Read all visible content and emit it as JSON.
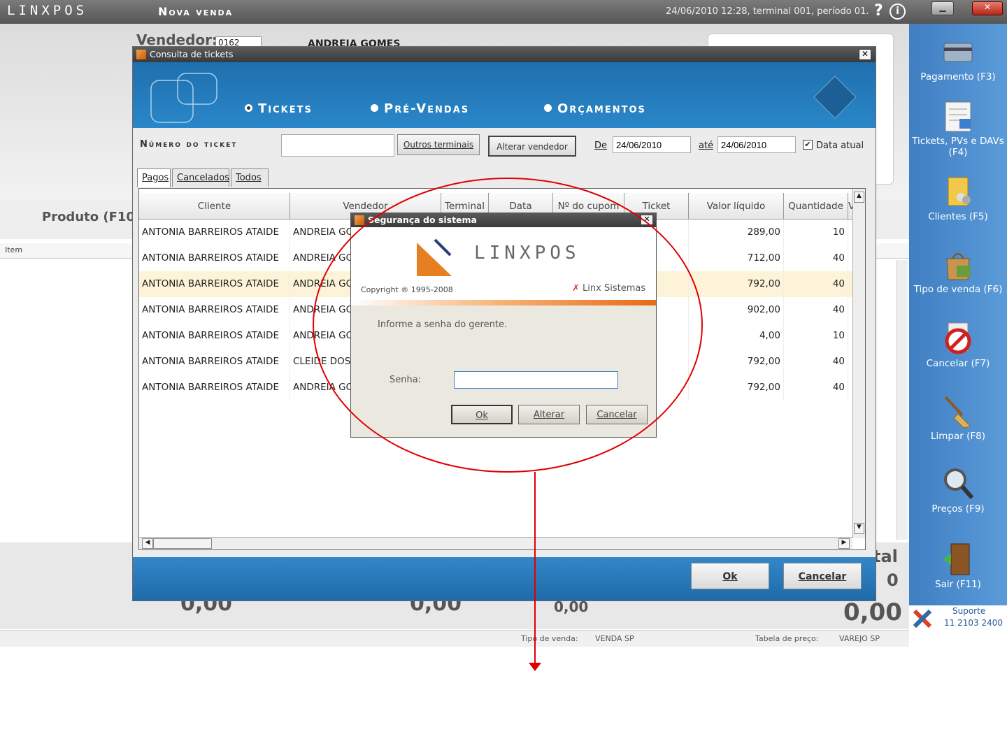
{
  "window": {
    "logo": "LINXPOS",
    "title": "Nova venda",
    "info": "24/06/2010 12:28, terminal 001, período 01."
  },
  "background": {
    "vendedor_label": "Vendedor:",
    "vendedor_code": "0162",
    "vendedor_name": "ANDREIA GOMES",
    "produto_label": "Produto (F10",
    "item_col": "Item",
    "total_label": "tal",
    "total_small": "0",
    "total_big": "0,00",
    "val1": "0,00",
    "val2": "0,00",
    "val3": "0,00",
    "tipo_venda_label": "Tipo de venda:",
    "tipo_venda": "VENDA SP",
    "tabela_label": "Tabela de preço:",
    "tabela": "VAREJO SP"
  },
  "sidebar": {
    "items": [
      {
        "label": "Pagamento (F3)",
        "icon": "card-icon"
      },
      {
        "label": "Tickets, PVs e DAVs (F4)",
        "icon": "receipt-icon"
      },
      {
        "label": "Clientes (F5)",
        "icon": "folder-users-icon"
      },
      {
        "label": "Tipo de venda (F6)",
        "icon": "shopping-bag-icon"
      },
      {
        "label": "Cancelar (F7)",
        "icon": "cancel-icon"
      },
      {
        "label": "Limpar (F8)",
        "icon": "broom-icon"
      },
      {
        "label": "Preços (F9)",
        "icon": "magnifier-icon"
      },
      {
        "label": "Sair (F11)",
        "icon": "door-icon"
      }
    ],
    "suporte_label": "Suporte",
    "suporte_phone": "11 2103 2400"
  },
  "consulta": {
    "title": "Consulta de tickets",
    "options": [
      "Tickets",
      "Pré-Vendas",
      "Orçamentos"
    ],
    "numero_label": "Número do ticket",
    "numero_value": "",
    "outros_terminais": "Outros terminais",
    "alterar_vendedor": "Alterar vendedor",
    "de_label": "De",
    "de_value": "24/06/2010",
    "ate_label": "até",
    "ate_value": "24/06/2010",
    "data_atual": "Data atual",
    "tabs": [
      "Pagos",
      "Cancelados",
      "Todos"
    ],
    "columns": [
      "Cliente",
      "Vendedor",
      "Terminal",
      "Data",
      "Nº do cupom",
      "Ticket",
      "Valor líquido",
      "Quantidade",
      "V"
    ],
    "rows": [
      {
        "cliente": "ANTONIA BARREIROS ATAIDE",
        "vendedor": "ANDREIA GOI",
        "ticket": "",
        "valor": "289,00",
        "qtd": "10"
      },
      {
        "cliente": "ANTONIA BARREIROS ATAIDE",
        "vendedor": "ANDREIA GOI",
        "ticket": "",
        "valor": "712,00",
        "qtd": "40"
      },
      {
        "cliente": "ANTONIA BARREIROS ATAIDE",
        "vendedor": "ANDREIA GOI",
        "ticket": "",
        "valor": "792,00",
        "qtd": "40"
      },
      {
        "cliente": "ANTONIA BARREIROS ATAIDE",
        "vendedor": "ANDREIA GOI",
        "ticket": "",
        "valor": "902,00",
        "qtd": "40"
      },
      {
        "cliente": "ANTONIA BARREIROS ATAIDE",
        "vendedor": "ANDREIA GOI",
        "ticket": "",
        "valor": "4,00",
        "qtd": "10"
      },
      {
        "cliente": "ANTONIA BARREIROS ATAIDE",
        "vendedor": "CLEIDE DOS !",
        "ticket": "",
        "valor": "792,00",
        "qtd": "40"
      },
      {
        "cliente": "ANTONIA BARREIROS ATAIDE",
        "vendedor": "ANDREIA GOI",
        "ticket": "",
        "valor": "792,00",
        "qtd": "40"
      }
    ],
    "ok": "Ok",
    "cancelar": "Cancelar"
  },
  "seguranca": {
    "title": "Segurança do sistema",
    "logo": "LINXPOS",
    "copyright": "Copyright ® 1995-2008",
    "brand": "Linx Sistemas",
    "message": "Informe a senha do gerente.",
    "senha_label": "Senha:",
    "senha_value": "",
    "ok": "Ok",
    "alterar": "Alterar",
    "cancelar": "Cancelar"
  },
  "colors": {
    "accent": "#2a87c9",
    "annotation": "#e00000"
  }
}
